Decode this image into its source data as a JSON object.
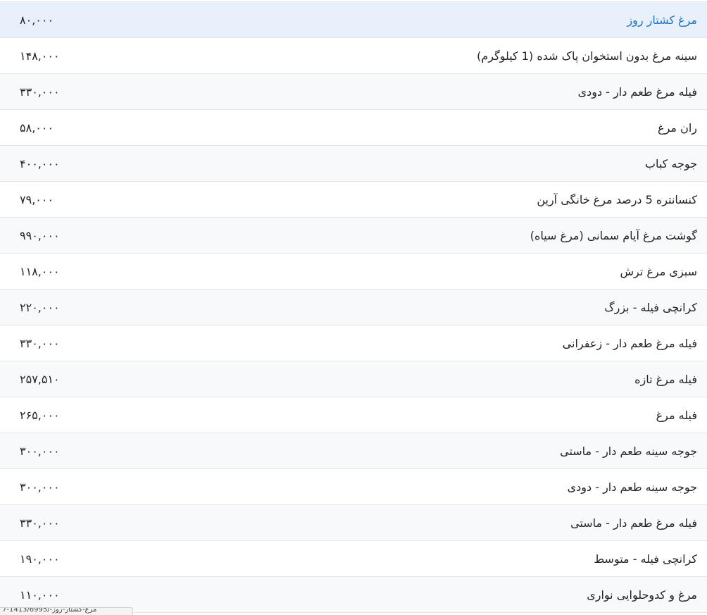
{
  "price_table": {
    "rows": [
      {
        "name": "مرغ کشتار روز",
        "price": "۸۰,۰۰۰"
      },
      {
        "name": "سینه مرغ بدون استخوان پاک شده (1 کیلوگرم)",
        "price": "۱۴۸,۰۰۰"
      },
      {
        "name": "فیله مرغ طعم دار - دودی",
        "price": "۳۳۰,۰۰۰"
      },
      {
        "name": "ران مرغ",
        "price": "۵۸,۰۰۰"
      },
      {
        "name": "جوجه کباب",
        "price": "۴۰۰,۰۰۰"
      },
      {
        "name": "کنسانتره 5 درصد مرغ خانگی آرین",
        "price": "۷۹,۰۰۰"
      },
      {
        "name": "گوشت مرغ آیام سمانی (مرغ سیاه)",
        "price": "۹۹۰,۰۰۰"
      },
      {
        "name": "سبزی مرغ ترش",
        "price": "۱۱۸,۰۰۰"
      },
      {
        "name": "کرانچی فیله - بزرگ",
        "price": "۲۲۰,۰۰۰"
      },
      {
        "name": "فیله مرغ طعم دار - زعفرانی",
        "price": "۳۳۰,۰۰۰"
      },
      {
        "name": "فیله مرغ تازه",
        "price": "۲۵۷,۵۱۰"
      },
      {
        "name": "فیله مرغ",
        "price": "۲۶۵,۰۰۰"
      },
      {
        "name": "جوجه سینه طعم دار - ماستی",
        "price": "۳۰۰,۰۰۰"
      },
      {
        "name": "جوجه سینه طعم دار - دودی",
        "price": "۳۰۰,۰۰۰"
      },
      {
        "name": "فیله مرغ طعم دار - ماستی",
        "price": "۳۳۰,۰۰۰"
      },
      {
        "name": "کرانچی فیله - متوسط",
        "price": "۱۹۰,۰۰۰"
      },
      {
        "name": "مرغ و کدوحلوایی نواری",
        "price": "۱۱۰,۰۰۰"
      }
    ]
  },
  "status_bar": {
    "url": "7-1413/6995/-مرغ-کشتار-روز"
  },
  "colors": {
    "link": "#1a73c8",
    "highlight_row": "#e8f1fb",
    "striped_row": "#f8f9fa",
    "border": "#e3e6ea"
  }
}
